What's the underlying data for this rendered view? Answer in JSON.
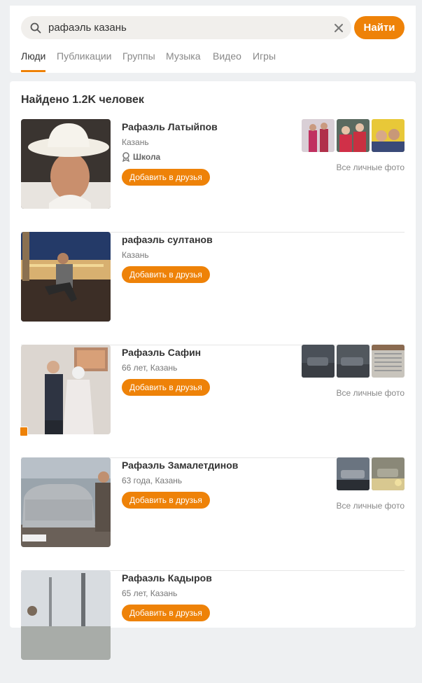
{
  "search": {
    "query": "рафаэль казань",
    "button_label": "Найти"
  },
  "tabs": [
    {
      "label": "Люди",
      "active": true
    },
    {
      "label": "Публикации"
    },
    {
      "label": "Группы"
    },
    {
      "label": "Музыка"
    },
    {
      "label": "Видео"
    },
    {
      "label": "Игры"
    }
  ],
  "results": {
    "heading": "Найдено 1.2K человек",
    "add_friend_label": "Добавить в друзья",
    "all_photos_label": "Все личные фото",
    "people": [
      {
        "name": "Рафаэль Латыйпов",
        "info": "Казань",
        "school": "Школа"
      },
      {
        "name": "рафаэль султанов",
        "info": "Казань"
      },
      {
        "name": "Рафаэль Сафин",
        "info": "66 лет, Казань"
      },
      {
        "name": "Рафаэль Замалетдинов",
        "info": "63 года, Казань"
      },
      {
        "name": "Рафаэль Кадыров",
        "info": "65 лет, Казань"
      }
    ]
  },
  "colors": {
    "accent": "#ee8208",
    "background": "#eef0f2"
  }
}
